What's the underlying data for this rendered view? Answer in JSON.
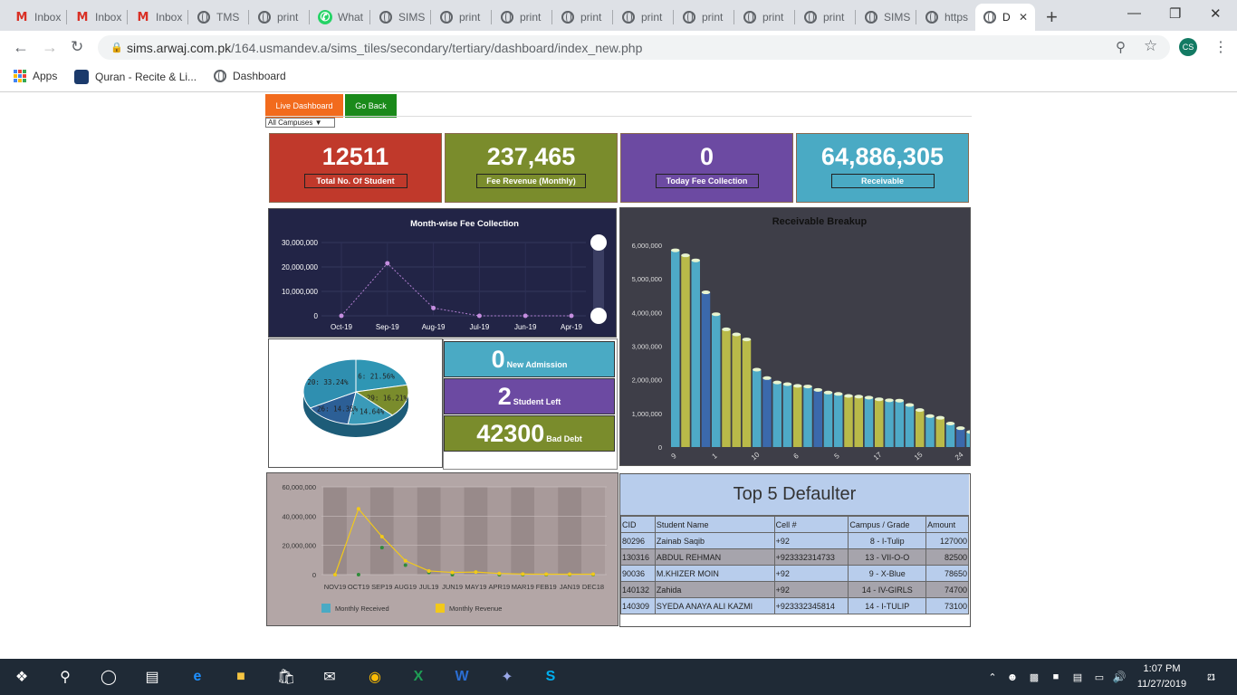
{
  "browser": {
    "tabs": [
      {
        "title": "Inbox",
        "icon": "gmail-icon"
      },
      {
        "title": "Inbox",
        "icon": "gmail-icon"
      },
      {
        "title": "Inbox",
        "icon": "gmail-icon"
      },
      {
        "title": "TMS",
        "icon": "globe-icon"
      },
      {
        "title": "print",
        "icon": "globe-icon"
      },
      {
        "title": "What",
        "icon": "whatsapp-icon"
      },
      {
        "title": "SIMS",
        "icon": "globe-icon"
      },
      {
        "title": "print",
        "icon": "globe-icon"
      },
      {
        "title": "print",
        "icon": "globe-icon"
      },
      {
        "title": "print",
        "icon": "globe-icon"
      },
      {
        "title": "print",
        "icon": "globe-icon"
      },
      {
        "title": "print",
        "icon": "globe-icon"
      },
      {
        "title": "print",
        "icon": "globe-icon"
      },
      {
        "title": "print",
        "icon": "globe-icon"
      },
      {
        "title": "SIMS",
        "icon": "globe-icon"
      },
      {
        "title": "https",
        "icon": "globe-icon"
      },
      {
        "title": "D",
        "icon": "globe-icon"
      }
    ],
    "url_host": "sims.arwaj.com.pk",
    "url_path": "/164.usmandev.a/sims_tiles/secondary/tertiary/dashboard/index_new.php",
    "profile_initials": "CS",
    "bookmarks": [
      "Apps",
      "Quran - Recite & Li...",
      "Dashboard"
    ]
  },
  "toolbar": {
    "live_label": "Live Dashboard",
    "back_label": "Go Back",
    "campus_select": "All Campuses"
  },
  "cards": [
    {
      "value": "12511",
      "label": "Total No. Of Student",
      "color": "#c0392b"
    },
    {
      "value": "237,465",
      "label": "Fee Revenue (Monthly)",
      "color": "#7a8c2c"
    },
    {
      "value": "0",
      "label": "Today Fee Collection",
      "color": "#6c4aa2"
    },
    {
      "value": "64,886,305",
      "label": "Receivable",
      "color": "#4aaac4"
    }
  ],
  "small_cards": [
    {
      "value": "0",
      "label": "New Admission",
      "color": "#4aaac4"
    },
    {
      "value": "2",
      "label": "Student Left",
      "color": "#6c4aa2"
    },
    {
      "value": "42300",
      "label": "Bad Debt",
      "color": "#7a8c2c"
    }
  ],
  "chart_data": [
    {
      "type": "line",
      "title": "Month-wise Fee Collection",
      "categories": [
        "Oct-19",
        "Sep-19",
        "Aug-19",
        "Jul-19",
        "Jun-19",
        "Apr-19"
      ],
      "values": [
        0,
        21500000,
        3200000,
        0,
        0,
        0
      ],
      "ylim": [
        0,
        30000000
      ],
      "yticks": [
        "30,000,000",
        "20,000,000",
        "10,000,000",
        "0"
      ]
    },
    {
      "type": "pie",
      "labels": [
        "6: 21.56%",
        "29: 16.21%",
        "2: 14.64%",
        "26: 14.35%",
        "20: 33.24%"
      ],
      "values": [
        21.56,
        16.21,
        14.64,
        14.35,
        33.24
      ],
      "colors": [
        "#2f96b4",
        "#7a8c2c",
        "#3a9ab8",
        "#2c5f96",
        "#2f8fb0"
      ]
    },
    {
      "type": "bar",
      "title": "Receivable Breakup",
      "categories": [
        "9",
        "",
        "",
        "",
        "1",
        "",
        "",
        "",
        "10",
        "",
        "",
        "",
        "6",
        "",
        "",
        "",
        "5",
        "",
        "",
        "",
        "17",
        "",
        "",
        "",
        "15",
        "",
        "",
        "",
        "24"
      ],
      "values": [
        5850000,
        5700000,
        5550000,
        4600000,
        3950000,
        3500000,
        3350000,
        3200000,
        2300000,
        2050000,
        1920000,
        1870000,
        1820000,
        1800000,
        1700000,
        1620000,
        1580000,
        1520000,
        1500000,
        1470000,
        1420000,
        1390000,
        1380000,
        1250000,
        1100000,
        920000,
        870000,
        700000,
        560000,
        450000,
        280000
      ],
      "ylim": [
        0,
        6000000
      ],
      "yticks": [
        "6,000,000",
        "5,000,000",
        "4,000,000",
        "3,000,000",
        "2,000,000",
        "1,000,000",
        "0"
      ]
    },
    {
      "type": "line",
      "categories": [
        "NOV19",
        "OCT19",
        "SEP19",
        "AUG19",
        "JUL19",
        "JUN19",
        "MAY19",
        "APR19",
        "MAR19",
        "FEB19",
        "JAN19",
        "DEC18"
      ],
      "series": [
        {
          "name": "Monthly Received",
          "values": [
            0,
            0,
            18500000,
            6500000,
            1500000,
            0,
            1800000,
            0,
            0,
            0,
            0,
            0
          ]
        },
        {
          "name": "Monthly Revenue",
          "values": [
            0,
            45000000,
            26000000,
            9500000,
            2500000,
            1500000,
            1800000,
            800000,
            400000,
            300000,
            300000,
            300000
          ]
        }
      ],
      "ylim": [
        0,
        60000000
      ],
      "yticks": [
        "60,000,000",
        "40,000,000",
        "20,000,000",
        "0"
      ]
    }
  ],
  "defaulters": {
    "title": "Top 5 Defaulter",
    "columns": [
      "CID",
      "Student Name",
      "Cell #",
      "Campus / Grade",
      "Amount"
    ],
    "rows": [
      [
        "80296",
        "Zainab Saqib",
        "+92",
        "8 - I-Tulip",
        "127000"
      ],
      [
        "130316",
        "ABDUL REHMAN",
        "+923332314733",
        "13 - VII-O-O",
        "82500"
      ],
      [
        "90036",
        "M.KHIZER MOIN",
        "+92",
        "9 - X-Blue",
        "78650"
      ],
      [
        "140132",
        "Zahida",
        "+92",
        "14 - IV-GIRLS",
        "74700"
      ],
      [
        "140309",
        "SYEDA ANAYA ALI KAZMI",
        "+923332345814",
        "14 - I-TULIP",
        "73100"
      ]
    ]
  },
  "taskbar": {
    "time": "1:07 PM",
    "date": "11/27/2019",
    "notif_count": "21"
  }
}
